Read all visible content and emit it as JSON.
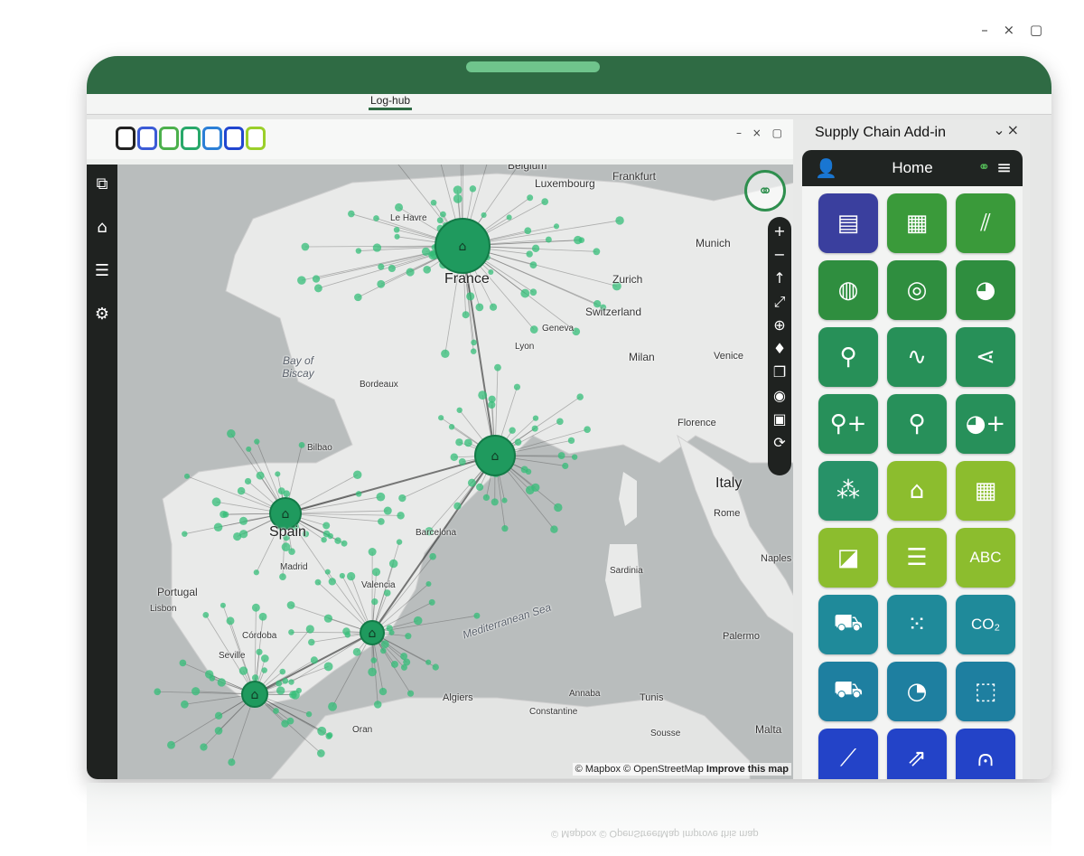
{
  "window": {
    "controls": "– × ▢",
    "tab_label": "Log-hub"
  },
  "swatches": [
    "#222222",
    "#3b5bd6",
    "#4cb04c",
    "#28a86a",
    "#2b7fd6",
    "#2146d0",
    "#9bcf2a"
  ],
  "app": {
    "controls": "– × ▢",
    "sidebar": [
      {
        "name": "windows-icon",
        "glyph": "⧉"
      },
      {
        "name": "home-icon",
        "glyph": "⌂"
      },
      {
        "name": "menu-icon",
        "glyph": "☰"
      },
      {
        "name": "gear-icon",
        "glyph": "⚙"
      }
    ],
    "map_tools": [
      {
        "name": "zoom-in-icon",
        "glyph": "+"
      },
      {
        "name": "zoom-out-icon",
        "glyph": "−"
      },
      {
        "name": "north-arrow-icon",
        "glyph": "↑"
      },
      {
        "name": "fullscreen-icon",
        "glyph": "⤢"
      },
      {
        "name": "globe-icon",
        "glyph": "⊕"
      },
      {
        "name": "pin-icon",
        "glyph": "♦"
      },
      {
        "name": "layers-icon",
        "glyph": "❐"
      },
      {
        "name": "camera-icon",
        "glyph": "◉"
      },
      {
        "name": "save-icon",
        "glyph": "▣"
      },
      {
        "name": "refresh-icon",
        "glyph": "⟳"
      }
    ]
  },
  "map": {
    "labels": {
      "belgium": "Belgium",
      "luxembourg": "Luxembourg",
      "frankfurt": "Frankfurt",
      "le_havre": "Le Havre",
      "munich": "Munich",
      "france": "France",
      "zurich": "Zurich",
      "switzerland": "Switzerland",
      "bay_of_biscay": "Bay of Biscay",
      "geneva": "Geneva",
      "lyon": "Lyon",
      "milan": "Milan",
      "venice": "Venice",
      "bordeaux": "Bordeaux",
      "florence": "Florence",
      "bilbao": "Bilbao",
      "italy": "Italy",
      "spain": "Spain",
      "barcelona": "Barcelona",
      "rome": "Rome",
      "madrid": "Madrid",
      "naples": "Naples",
      "portugal": "Portugal",
      "lisbon": "Lisbon",
      "sardinia": "Sardinia",
      "valencia": "Valencia",
      "mediterranean_sea": "Mediterranean Sea",
      "cordoba": "Córdoba",
      "seville": "Seville",
      "palermo": "Palermo",
      "algiers": "Algiers",
      "annaba": "Annaba",
      "tunis": "Tunis",
      "constantine": "Constantine",
      "oran": "Oran",
      "sousse": "Sousse",
      "malta": "Malta"
    },
    "attribution": {
      "mapbox": "© Mapbox",
      "osm": "© OpenStreetMap",
      "improve": "Improve this map"
    }
  },
  "panel": {
    "title": "Supply Chain Add-in",
    "controls": "⌄×",
    "header": "Home",
    "tiles": [
      {
        "name": "dashboard-icon",
        "glyph": "▤",
        "color": "#3a3f9e"
      },
      {
        "name": "map-icon",
        "glyph": "▦",
        "color": "#3a9a3a"
      },
      {
        "name": "road-icon",
        "glyph": "⫽",
        "color": "#3a9a3a"
      },
      {
        "name": "globe-icon",
        "glyph": "◍",
        "color": "#2f8e3f"
      },
      {
        "name": "target-icon",
        "glyph": "◎",
        "color": "#2f8e3f"
      },
      {
        "name": "network-globe-icon",
        "glyph": "◕",
        "color": "#2f8e3f"
      },
      {
        "name": "location-icon",
        "glyph": "⚲",
        "color": "#279058"
      },
      {
        "name": "route-icon",
        "glyph": "∿",
        "color": "#279058"
      },
      {
        "name": "share-icon",
        "glyph": "⋖",
        "color": "#279058"
      },
      {
        "name": "add-location-icon",
        "glyph": "⚲+",
        "color": "#27905a"
      },
      {
        "name": "pin-location-icon",
        "glyph": "⚲",
        "color": "#27905a"
      },
      {
        "name": "add-globe-icon",
        "glyph": "◕+",
        "color": "#27905a"
      },
      {
        "name": "network-icon",
        "glyph": "⁂",
        "color": "#279268"
      },
      {
        "name": "warehouse-icon",
        "glyph": "⌂",
        "color": "#8cbd2e"
      },
      {
        "name": "grid-icon",
        "glyph": "▦",
        "color": "#8cbd2e"
      },
      {
        "name": "area-chart-icon",
        "glyph": "◪",
        "color": "#8cbd2e"
      },
      {
        "name": "list-icon",
        "glyph": "☰",
        "color": "#8cbd2e"
      },
      {
        "name": "abc-icon",
        "glyph": "ABC",
        "color": "#8cbd2e",
        "text": true
      },
      {
        "name": "truck-load-icon",
        "glyph": "⛟",
        "color": "#1f8a9a"
      },
      {
        "name": "scatter-icon",
        "glyph": "⁙",
        "color": "#1f8a9a"
      },
      {
        "name": "co2-icon",
        "glyph": "CO₂",
        "color": "#1f8a9a",
        "text": true
      },
      {
        "name": "truck-icon",
        "glyph": "⛟",
        "color": "#1e7fa0"
      },
      {
        "name": "gauge-icon",
        "glyph": "◔",
        "color": "#1e7fa0"
      },
      {
        "name": "box-icon",
        "glyph": "⬚",
        "color": "#1e7fa0"
      },
      {
        "name": "line-chart-icon",
        "glyph": "⟋",
        "color": "#2343c8"
      },
      {
        "name": "growth-chart-icon",
        "glyph": "⇗",
        "color": "#2343c8"
      },
      {
        "name": "distribution-icon",
        "glyph": "⩀",
        "color": "#2343c8"
      }
    ]
  }
}
